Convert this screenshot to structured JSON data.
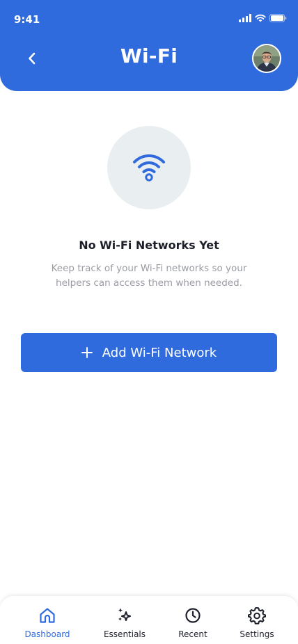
{
  "status_bar": {
    "time": "9:41",
    "icons": [
      "cellular-signal-icon",
      "wifi-signal-icon",
      "battery-icon"
    ]
  },
  "header": {
    "title": "Wi-Fi",
    "back_icon": "chevron-left-icon",
    "avatar": "user-avatar"
  },
  "empty_state": {
    "icon": "wifi-icon",
    "title": "No Wi-Fi Networks Yet",
    "description": "Keep track of your Wi-Fi networks so your helpers can access them when needed."
  },
  "add_button": {
    "icon": "plus-icon",
    "label": "Add Wi-Fi Network"
  },
  "bottom_nav": {
    "items": [
      {
        "label": "Dashboard",
        "icon": "home-icon",
        "active": true
      },
      {
        "label": "Essentials",
        "icon": "sparkle-icon",
        "active": false
      },
      {
        "label": "Recent",
        "icon": "clock-icon",
        "active": false
      },
      {
        "label": "Settings",
        "icon": "gear-icon",
        "active": false
      }
    ]
  },
  "colors": {
    "primary": "#2f6bdc",
    "text_dark": "#1c1f2a",
    "text_muted": "#9a9ca4",
    "icon_circle_bg": "#e9eef1",
    "background": "#ffffff"
  }
}
